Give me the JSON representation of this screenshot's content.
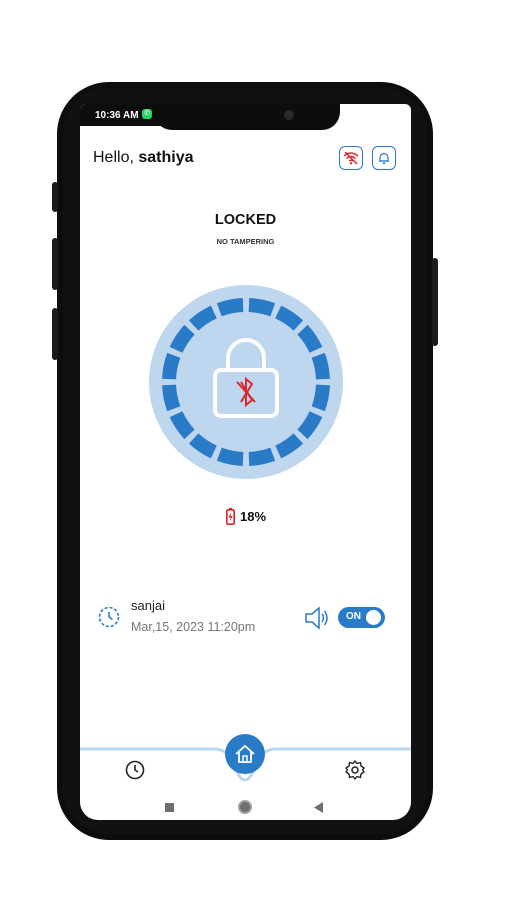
{
  "status_bar": {
    "time": "10:36 AM",
    "notification_icon": "whatsapp-icon"
  },
  "header": {
    "greeting": "Hello,",
    "username": "sathiya",
    "wifi_icon": "wifi-off-icon",
    "bell_icon": "bell-icon"
  },
  "lock_state": {
    "title": "LOCKED",
    "subtitle": "NO TAMPERING",
    "icon": "padlock-bluetooth-off-icon"
  },
  "battery": {
    "percent_text": "18%",
    "level": 0.18,
    "color": "#e0201c"
  },
  "activity": {
    "user": "sanjai",
    "timestamp": "Mar,15, 2023 11:20pm",
    "sound_icon": "speaker-icon",
    "toggle_label": "ON"
  },
  "nav": {
    "history_icon": "clock-icon",
    "home_icon": "home-icon",
    "settings_icon": "gear-icon"
  },
  "colors": {
    "accent": "#2a7bc7",
    "ring_light": "#bed6ee",
    "alert": "#d92b2b"
  }
}
